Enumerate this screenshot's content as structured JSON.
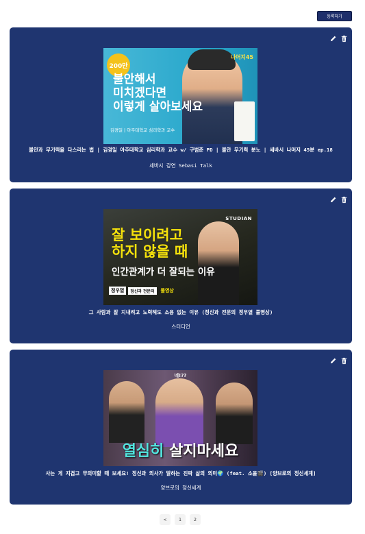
{
  "header": {
    "register_label": "등록하기"
  },
  "cards": [
    {
      "title": "불안과 무기력을 다스리는 법 | 김경일 아주대학교 심리학과 교수 w/ 구범준 PD | 불안 무기력 분노 | 세바시 나머지 45분 ep.18",
      "channel": "세바시 강연 Sebasi Talk",
      "thumb": {
        "badge": "200만",
        "line1": "불안해서",
        "line2": "미치겠다면",
        "line3": "이렇게 살아보세요",
        "caption": "김경일 | 아주대학교 심리학과 교수",
        "corner": "나머지45"
      }
    },
    {
      "title": "그 사람과 잘 지내려고 노력해도 소용 없는 이유 (정신과 전문의 정우열 풀영상)",
      "channel": "스터디언",
      "thumb": {
        "brand": "STUDIAN",
        "line1": "잘 보이려고",
        "line2": "하지 않을 때",
        "line3": "인간관계가 더 잘되는 이유",
        "caption_name": "정우열",
        "caption_role": "정신과 전문의",
        "caption_tag": "풀영상"
      }
    },
    {
      "title": "사는 게 지겹고 무의미할 때 보세요! 정신과 의사가 말하는 진짜 삶의 의미🌍 (feat. 소울🎬) [양브로의 정신세계]",
      "channel": "양브로의 정신세계",
      "thumb": {
        "top": "네!??",
        "headline_a": "열심히",
        "headline_b": " 살지마세요"
      }
    }
  ],
  "pagination": {
    "prev": "<",
    "pages": [
      "1",
      "2"
    ]
  },
  "colors": {
    "card_bg": "#1f3570",
    "button_bg": "#1e2f6b"
  }
}
